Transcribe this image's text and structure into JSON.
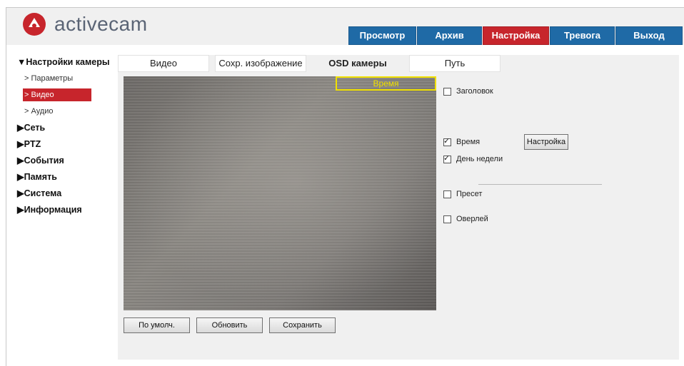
{
  "brand": {
    "name": "activecam",
    "accent": "#c7252c",
    "nav_blue": "#1f6aa6"
  },
  "topnav": [
    {
      "label": "Просмотр",
      "active": false
    },
    {
      "label": "Архив",
      "active": false
    },
    {
      "label": "Настройка",
      "active": true
    },
    {
      "label": "Тревога",
      "active": false
    },
    {
      "label": "Выход",
      "active": false
    }
  ],
  "sidebar": {
    "camera_settings": "▼Настройки камеры",
    "sub": [
      "> Параметры",
      "> Видео",
      "> Аудио"
    ],
    "sections": [
      "▶Сеть",
      "▶PTZ",
      "▶События",
      "▶Память",
      "▶Система",
      "▶Информация"
    ]
  },
  "tabs": [
    "Видео",
    "Сохр. изображение",
    "OSD камеры",
    "Путь"
  ],
  "osd": {
    "time_overlay": "Время"
  },
  "options": {
    "title": {
      "label": "Заголовок",
      "checked": false
    },
    "time": {
      "label": "Время",
      "checked": true
    },
    "weekday": {
      "label": "День недели",
      "checked": true
    },
    "preset": {
      "label": "Пресет",
      "checked": false
    },
    "overlay": {
      "label": "Оверлей",
      "checked": false
    }
  },
  "buttons": {
    "settings": "Настройка",
    "default": "По умолч.",
    "refresh": "Обновить",
    "save": "Сохранить"
  }
}
